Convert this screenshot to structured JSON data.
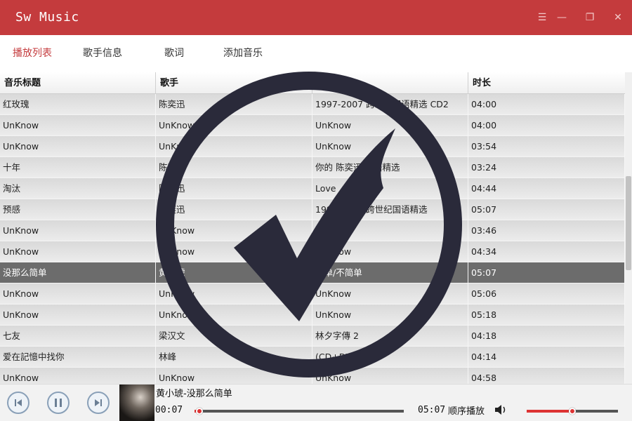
{
  "app": {
    "title": "Sw Music"
  },
  "window_controls": [
    {
      "name": "menu-icon",
      "glyph": "☰"
    },
    {
      "name": "minimize-icon",
      "glyph": "—"
    },
    {
      "name": "restore-icon",
      "glyph": "❐"
    },
    {
      "name": "close-icon",
      "glyph": "✕"
    }
  ],
  "menu": {
    "items": [
      {
        "label": "播放列表",
        "active": true
      },
      {
        "label": "歌手信息",
        "active": false
      },
      {
        "label": "歌词",
        "active": false
      },
      {
        "label": "添加音乐",
        "active": false
      }
    ]
  },
  "table": {
    "columns": [
      "音乐标题",
      "歌手",
      "",
      "时长"
    ],
    "rows": [
      {
        "title": "红玫瑰",
        "artist": "陈奕迅",
        "album": "1997-2007 跨世纪国语精选 CD2",
        "duration": "04:00",
        "selected": false
      },
      {
        "title": "UnKnow",
        "artist": "UnKnow",
        "album": "UnKnow",
        "duration": "04:00",
        "selected": false
      },
      {
        "title": "UnKnow",
        "artist": "UnKnow",
        "album": "UnKnow",
        "duration": "03:54",
        "selected": false
      },
      {
        "title": "十年",
        "artist": "陈奕迅",
        "album": "你的 陈奕迅 国语精选",
        "duration": "03:24",
        "selected": false
      },
      {
        "title": "淘汰",
        "artist": "陈奕迅",
        "album": "Love",
        "duration": "04:44",
        "selected": false
      },
      {
        "title": "预感",
        "artist": "陈奕迅",
        "album": "1997-2007 跨世纪国语精选",
        "duration": "05:07",
        "selected": false
      },
      {
        "title": "UnKnow",
        "artist": "UnKnow",
        "album": "UnKnow",
        "duration": "03:46",
        "selected": false
      },
      {
        "title": "UnKnow",
        "artist": "UnKnow",
        "album": "UnKnow",
        "duration": "04:34",
        "selected": false
      },
      {
        "title": "没那么简单",
        "artist": "黄小琥",
        "album": "简单/不简单",
        "duration": "05:07",
        "selected": true
      },
      {
        "title": "UnKnow",
        "artist": "UnKnow",
        "album": "UnKnow",
        "duration": "05:06",
        "selected": false
      },
      {
        "title": "UnKnow",
        "artist": "UnKnow",
        "album": "UnKnow",
        "duration": "05:18",
        "selected": false
      },
      {
        "title": "七友",
        "artist": "梁汉文",
        "album": "林夕字傳 2",
        "duration": "04:18",
        "selected": false
      },
      {
        "title": "爱在記憶中找你",
        "artist": "林峰",
        "album": "(CD+DVD)",
        "duration": "04:14",
        "selected": false
      },
      {
        "title": "UnKnow",
        "artist": "UnKnow",
        "album": "UnKnow",
        "duration": "04:58",
        "selected": false
      }
    ]
  },
  "player": {
    "now_playing": "黄小琥-没那么简单",
    "current_time": "00:07",
    "total_time": "05:07",
    "progress_fraction": 0.023,
    "play_mode": "顺序播放",
    "volume_fraction": 0.5,
    "accent_color": "#d33333"
  },
  "colors": {
    "titlebar": "#c43b3d",
    "selected_row": "#6c6c6c",
    "overlay_check": "#2a2a3a"
  }
}
